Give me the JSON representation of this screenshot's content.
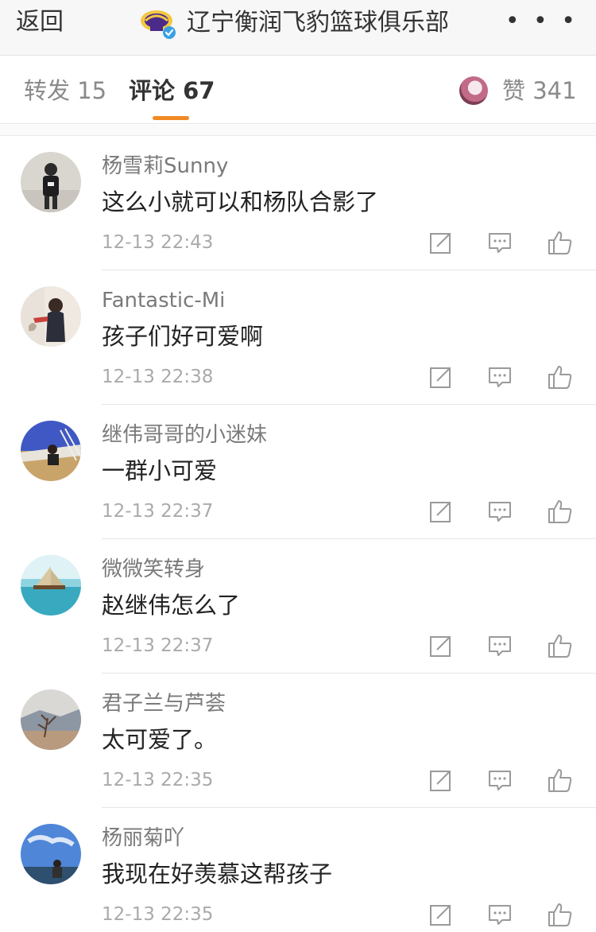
{
  "header": {
    "back_label": "返回",
    "title": "辽宁衡润飞豹篮球俱乐部",
    "more_label": "• • •",
    "logo_icon": "liaoning-club-logo",
    "verified_icon": "verified-badge-icon"
  },
  "tabs": {
    "repost_label": "转发 15",
    "comment_label": "评论 67",
    "like_label": "赞 341",
    "active": "comment",
    "accent_color": "#f08a24"
  },
  "comments": [
    {
      "user": "杨雪莉Sunny",
      "text": "这么小就可以和杨队合影了",
      "time": "12-13 22:43"
    },
    {
      "user": "Fantastic-Mi",
      "text": "孩子们好可爱啊",
      "time": "12-13 22:38"
    },
    {
      "user": "继伟哥哥的小迷妹",
      "text": "一群小可爱",
      "time": "12-13 22:37"
    },
    {
      "user": "微微笑转身",
      "text": "赵继伟怎么了",
      "time": "12-13 22:37"
    },
    {
      "user": "君子兰与芦荟",
      "text": "太可爱了。",
      "time": "12-13 22:35"
    },
    {
      "user": "杨丽菊吖",
      "text": "我现在好羡慕这帮孩子",
      "time": "12-13 22:35"
    }
  ],
  "icons": {
    "share": "repost-icon",
    "reply": "comment-icon",
    "like": "thumbs-up-icon"
  }
}
